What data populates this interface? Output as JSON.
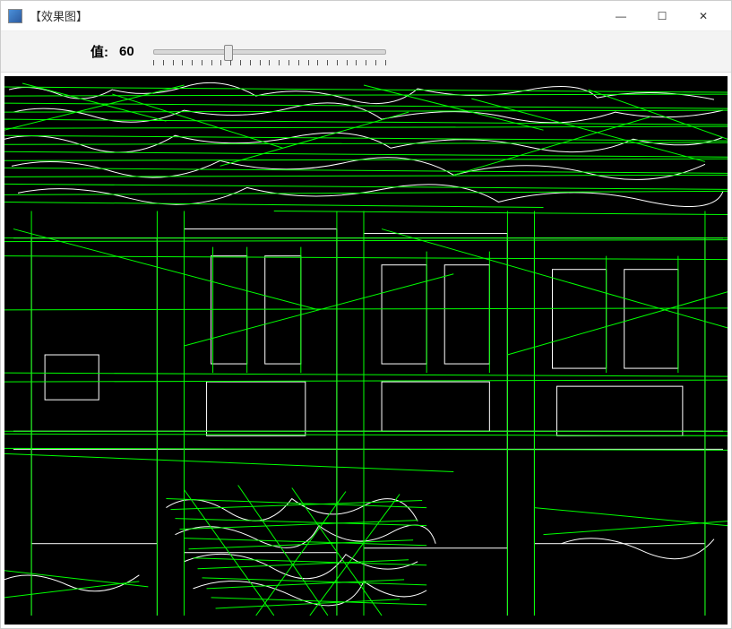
{
  "window": {
    "title": "【效果图】",
    "icon_name": "app-icon"
  },
  "toolbar": {
    "slider": {
      "label": "值:",
      "value": "60",
      "position_percent": 32,
      "min": 0,
      "max": 200
    }
  },
  "controls": {
    "minimize_glyph": "—",
    "maximize_glyph": "☐",
    "close_glyph": "✕"
  },
  "image": {
    "description": "Canny edge detection output with Hough line overlay",
    "edge_color": "#ffffff",
    "line_color": "#00ff00",
    "background": "#000000"
  }
}
